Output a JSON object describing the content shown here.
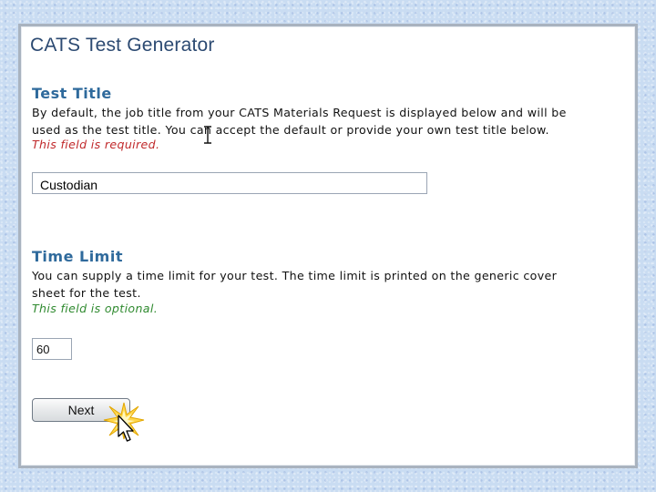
{
  "app": {
    "title": "CATS Test Generator"
  },
  "test_title": {
    "heading": "Test Title",
    "description_line1": "By default, the job title from your CATS Materials Request is displayed below and will be",
    "description_line2": "used as the test title. You can accept the default or provide your own test title below.",
    "required_note": "This field is required.",
    "value": "Custodian"
  },
  "time_limit": {
    "heading": "Time Limit",
    "description_line1": "You can supply a time limit for your test.  The time limit is printed on the generic cover",
    "description_line2": "sheet for the test.",
    "optional_note": "This field is optional.",
    "value": "60"
  },
  "buttons": {
    "next_label": "Next"
  },
  "icons": {
    "ibeam": "text-cursor-icon",
    "click": "click-burst-icon",
    "pointer": "mouse-pointer-icon"
  },
  "colors": {
    "title": "#2c4a72",
    "heading": "#2f6a9c",
    "required": "#c0282a",
    "optional": "#2f8a2f",
    "background": "#c9dcf2"
  }
}
